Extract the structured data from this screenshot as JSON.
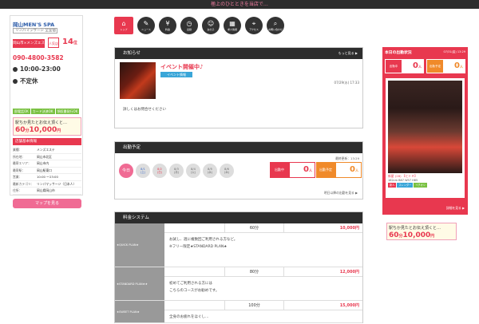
{
  "topbar": {
    "text": "極上のひとときを当店で…"
  },
  "shop": {
    "name": "岡山MEN'S SPA",
    "sub": "リンパマッサージ 全室個",
    "rank_label": "岡山市×メンズエステ",
    "rank_badge": "人気店",
    "rank_value": "14",
    "rank_unit": "位",
    "phone": "090-4800-3582",
    "hours": "10:00-23:00",
    "holiday": "不定休",
    "tags": [
      "即電話OK",
      "カード決済OK",
      "領収書発行OK"
    ],
    "promo_line": "駅ちか見たとお伝え頂くと…",
    "promo_min": "60",
    "promo_min_unit": "分",
    "promo_price": "10,000",
    "promo_price_unit": "円",
    "info_header": "店舗基本情報",
    "info": [
      {
        "k": "業種：",
        "v": "メンズエステ"
      },
      {
        "k": "所在地：",
        "v": "岡山市北区"
      },
      {
        "k": "最寄エリア：",
        "v": "岡山市内"
      },
      {
        "k": "最寄駅：",
        "v": "岡山駅東口"
      },
      {
        "k": "営業：",
        "v": "10:00 ～23:00"
      },
      {
        "k": "最新カテゴリ：",
        "v": "リンパマッサージ（日本人）"
      },
      {
        "k": "住所：",
        "v": "岡山県岡山市"
      }
    ],
    "map_button": "マップを見る"
  },
  "nav": [
    {
      "label": "トップ",
      "icon": "⌂"
    },
    {
      "label": "ニュース",
      "icon": "✎"
    },
    {
      "label": "料金",
      "icon": "¥"
    },
    {
      "label": "出勤",
      "icon": "◷"
    },
    {
      "label": "女の子",
      "icon": "☺"
    },
    {
      "label": "求人情報",
      "icon": "▦"
    },
    {
      "label": "アクセス",
      "icon": "⌖"
    },
    {
      "label": "お問い合わせ",
      "icon": "⌕"
    }
  ],
  "notice": {
    "header": "お知らせ",
    "more": "もっと見る ▶",
    "title": "イベント開催中♪",
    "tag": "イベント情報",
    "date": "07/29(水) 17:33",
    "text": "詳しくはお問合せください"
  },
  "schedule": {
    "header": "出勤予定",
    "updated": "最終更新：13:29",
    "days": [
      {
        "l1": "今日",
        "l2": "",
        "kind": "active"
      },
      {
        "l1": "8/1",
        "l2": "(土)",
        "kind": "sat"
      },
      {
        "l1": "8/2",
        "l2": "(日)",
        "kind": "sun"
      },
      {
        "l1": "8/3",
        "l2": "(月)",
        "kind": ""
      },
      {
        "l1": "8/4",
        "l2": "(火)",
        "kind": ""
      },
      {
        "l1": "8/5",
        "l2": "(水)",
        "kind": ""
      },
      {
        "l1": "8/6",
        "l2": "(木)",
        "kind": ""
      }
    ],
    "working_label": "出勤中",
    "working_value": "0",
    "upcoming_label": "出勤予定",
    "upcoming_value": "0",
    "unit": "人",
    "link": "明日以降の出勤を見る ▶"
  },
  "price": {
    "header": "料金システム",
    "plans": [
      {
        "name": "★QUICK PLAN★",
        "min": "60分",
        "price": "10,000円",
        "lines": [
          "お試し、週に複数回ご利用される方など。",
          "※フリー限定★STANDARD PLAN★"
        ]
      },
      {
        "name": "★STANDARD PLAN★★",
        "min": "80分",
        "price": "12,000円",
        "lines": [
          "初めてご利用される方には",
          "こちらのコースがお勧めです。"
        ]
      },
      {
        "name": "★SWEET PLAN★",
        "min": "100分",
        "price": "15,000円",
        "lines": [
          "全身のお疲れをほぐし…"
        ]
      }
    ]
  },
  "today": {
    "title": "本日の出勤状況",
    "updated": "07/31(金) 13:29",
    "working_label": "出勤中",
    "working_value": "0",
    "upcoming_label": "出勤予定",
    "upcoming_value": "0",
    "unit": "人",
    "girl_name": "新星 (28) 【ヒトミ】",
    "girl_size": "162cm B87 W57 H85",
    "girl_tags": [
      "新人",
      "スレンダー",
      "イチオシ"
    ],
    "link": "詳細を見る ▶"
  },
  "colors": {
    "accent": "#e8384f",
    "orange": "#f08a2a",
    "dark": "#2d2d2d",
    "blue": "#3aa6d8",
    "green": "#7ac142"
  }
}
